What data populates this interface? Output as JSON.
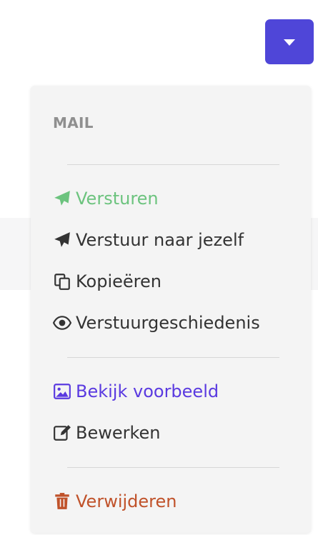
{
  "menu": {
    "header": "MAIL",
    "items": [
      {
        "label": "Versturen",
        "icon": "paper-plane-icon",
        "color": "#6cc37e"
      },
      {
        "label": "Verstuur naar jezelf",
        "icon": "paper-plane-icon",
        "color": "#333333"
      },
      {
        "label": "Kopieëren",
        "icon": "copy-icon",
        "color": "#333333"
      },
      {
        "label": "Verstuurgeschiedenis",
        "icon": "eye-icon",
        "color": "#333333"
      },
      {
        "label": "Bekijk voorbeeld",
        "icon": "image-icon",
        "color": "#5a3ae0"
      },
      {
        "label": "Bewerken",
        "icon": "edit-icon",
        "color": "#333333"
      },
      {
        "label": "Verwijderen",
        "icon": "trash-icon",
        "color": "#c0522a"
      }
    ]
  },
  "toggle": {
    "icon": "caret-down-icon",
    "color": "#4f46d8"
  }
}
